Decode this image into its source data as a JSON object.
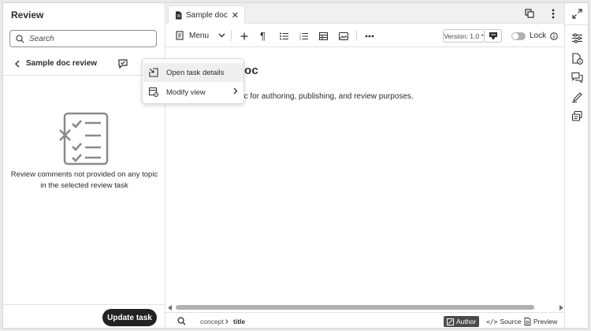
{
  "left_panel": {
    "title": "Review",
    "search_placeholder": "Search",
    "review_title": "Sample doc review",
    "empty_message": "Review comments not provided on any topic in the selected review task",
    "update_button": "Update task"
  },
  "popup_menu": {
    "items": [
      {
        "label": "Open task details",
        "icon": "open-in-icon"
      },
      {
        "label": "Modify view",
        "icon": "view-settings-icon"
      }
    ]
  },
  "editor": {
    "tab_label": "Sample doc",
    "toolbar": {
      "menu_label": "Menu",
      "version_label": "Version: 1.0 *",
      "lock_label": "Lock"
    },
    "doc_title_visible": "oc",
    "doc_text_visible": "oc for authoring, publishing, and review purposes."
  },
  "status_bar": {
    "breadcrumb": [
      "concept",
      "title"
    ],
    "modes": [
      {
        "label": "Author",
        "active": true
      },
      {
        "label": "Source",
        "active": false
      },
      {
        "label": "Preview",
        "active": false
      }
    ]
  },
  "right_rail": {
    "icons": [
      "properties-icon",
      "file-info-icon",
      "comments-icon",
      "edit-attributes-icon",
      "references-icon"
    ]
  },
  "colors": {
    "dark_button": "#222222",
    "active_mode": "#4b4b4b",
    "scrollbar": "#b1b1b1",
    "border": "#e1e1e1"
  }
}
